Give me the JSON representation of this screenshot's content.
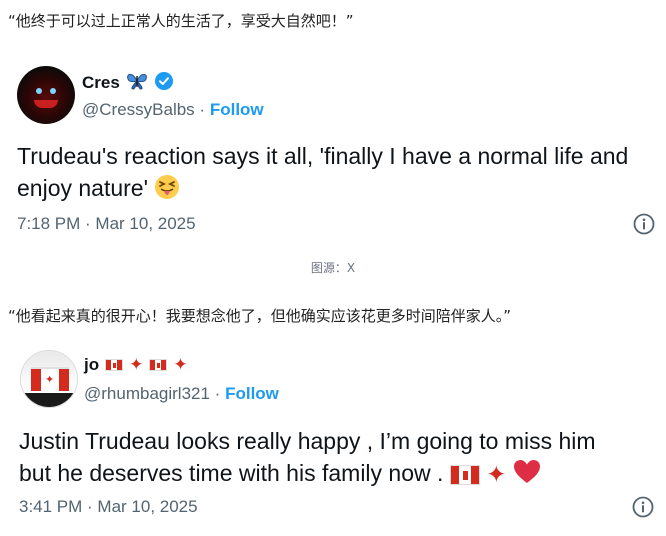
{
  "quotes": {
    "first": "“他终于可以过上正常人的生活了，享受大自然吧！”",
    "second": "“他看起来真的很开心！我要想念他了，但他确实应该花更多时间陪伴家人。”"
  },
  "captions": {
    "first": "图源：X"
  },
  "tweets": [
    {
      "display_name": "Cres",
      "name_badge": "butterfly-emoji",
      "verified_icon": "verified-badge-icon",
      "handle": "@CressyBalbs",
      "separator": "·",
      "follow_label": "Follow",
      "text": "Trudeau's reaction says it all, 'finally I have a normal life and enjoy nature'",
      "text_emoji": "squinting-face-with-tongue-emoji",
      "timestamp": "7:18 PM · Mar 10, 2025",
      "info_icon": "info-icon"
    },
    {
      "display_name": "jo",
      "name_emojis": [
        "canada-flag-emoji",
        "maple-leaf-emoji",
        "canada-flag-emoji",
        "maple-leaf-emoji"
      ],
      "handle": "@rhumbagirl321",
      "separator": "·",
      "follow_label": "Follow",
      "text_line1": "Justin Trudeau looks really happy , I’m going to miss him",
      "text_line2": "but he deserves time with his family now .",
      "text_emojis": [
        "canada-flag-emoji",
        "maple-leaf-emoji",
        "red-heart-emoji"
      ],
      "timestamp": "3:41 PM · Mar 10, 2025",
      "info_icon": "info-icon"
    }
  ],
  "colors": {
    "link_blue": "#1d9bf0",
    "secondary_text": "#536471",
    "primary_text": "#0f1419",
    "canada_red": "#d52b1e"
  }
}
